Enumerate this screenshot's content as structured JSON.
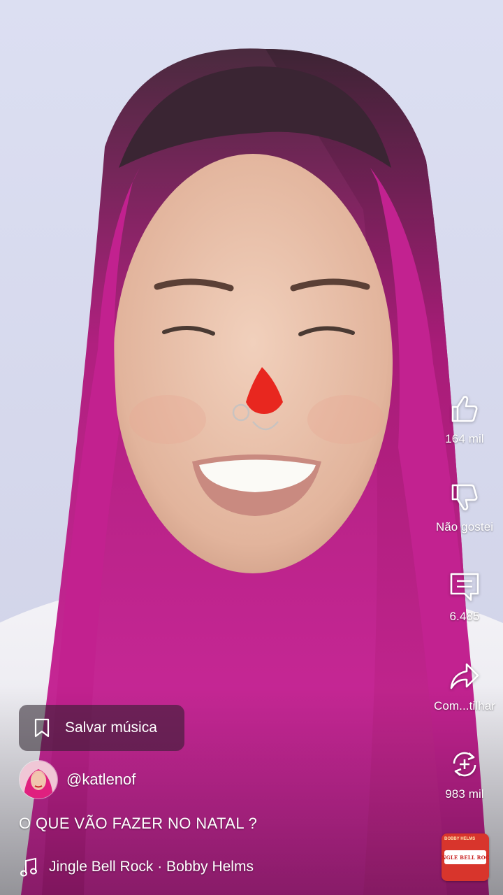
{
  "actions": {
    "like_count": "164 mil",
    "dislike_label": "Não gostei",
    "comment_count": "6.485",
    "share_label": "Com...tilhar",
    "remix_count": "983 mil"
  },
  "save_music": {
    "label": "Salvar música"
  },
  "channel": {
    "handle": "@katlenof"
  },
  "caption": "O QUE VÃO FAZER NO NATAL ?",
  "music": {
    "track": "Jingle Bell Rock · Bobby Helms",
    "album_artist": "BOBBY HELMS",
    "album_title": "JINGLE BELL ROCK"
  },
  "icons": {
    "like": "thumbs-up-icon",
    "dislike": "thumbs-down-icon",
    "comment": "comment-icon",
    "share": "share-arrow-icon",
    "remix": "remix-icon",
    "bookmark": "bookmark-icon",
    "music_note": "music-note-icon"
  },
  "colors": {
    "overlay_text": "#ffffff",
    "save_pill_bg": "rgba(40,30,40,0.55)",
    "album_red": "#d8352c",
    "background": "#d9dcef"
  }
}
